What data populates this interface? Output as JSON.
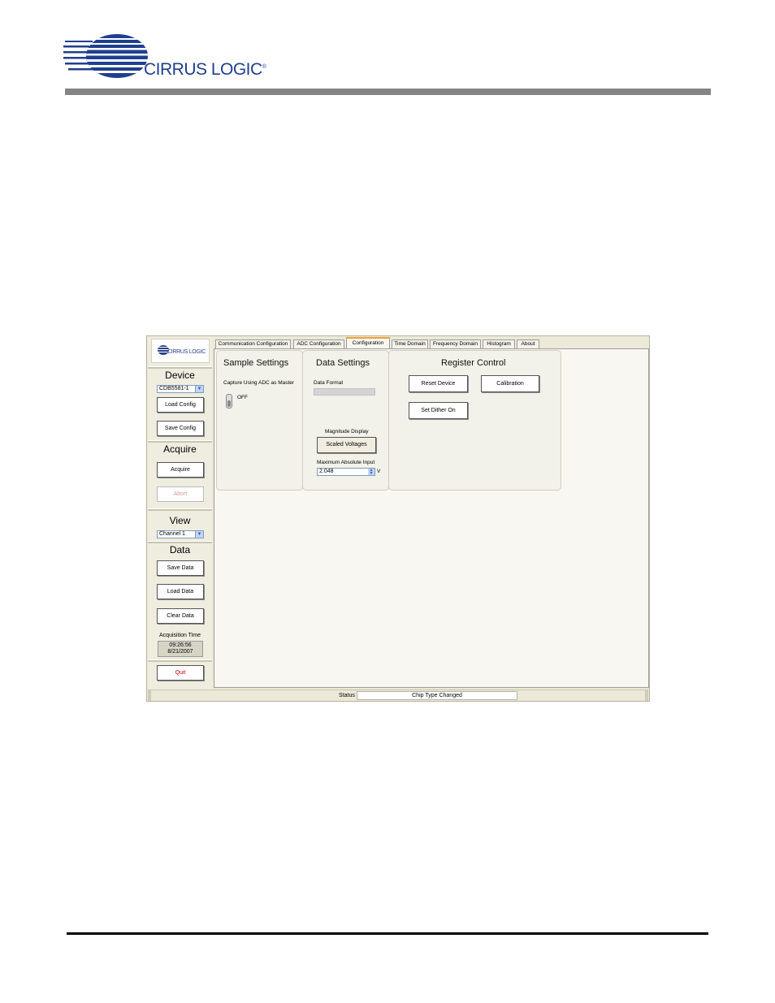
{
  "header": {
    "brand": "CIRRUS LOGIC",
    "registered": "®"
  },
  "sidebar": {
    "logo_text": "CIRRUS LOGIC",
    "device": {
      "heading": "Device",
      "selected_device": "CDB5581-1",
      "load_config": "Load Config",
      "save_config": "Save Config"
    },
    "acquire": {
      "heading": "Acquire",
      "acquire_button": "Acquire",
      "abort_button": "Abort"
    },
    "view": {
      "heading": "View",
      "selected_channel": "Channel 1"
    },
    "data": {
      "heading": "Data",
      "save_data": "Save Data",
      "load_data": "Load Data",
      "clear_data": "Clear Data",
      "acquisition_label": "Acquisition Time",
      "acquisition_time": "09:26:56",
      "acquisition_date": "8/21/2007"
    },
    "quit_button": "Quit"
  },
  "tabs": [
    {
      "label": "Communication Configuration"
    },
    {
      "label": "ADC Configuration"
    },
    {
      "label": "Configuration"
    },
    {
      "label": "Time Domain"
    },
    {
      "label": "Frequency Domain"
    },
    {
      "label": "Histogram"
    },
    {
      "label": "About"
    }
  ],
  "active_tab": "Configuration",
  "sample_settings": {
    "title": "Sample Settings",
    "capture_label": "Capture Using ADC as Master",
    "toggle_state": "OFF"
  },
  "data_settings": {
    "title": "Data Settings",
    "data_format_label": "Data Format",
    "magnitude_label": "Magnitude Display",
    "magnitude_button": "Scaled Voltages",
    "max_input_label": "Maximum Absolute Input",
    "max_input_value": "2.048",
    "max_input_unit": "V"
  },
  "register_control": {
    "title": "Register Control",
    "reset_device": "Reset Device",
    "calibration": "Calibration",
    "set_dither": "Set Dither On"
  },
  "status": {
    "label": "Status",
    "message": "Chip Type Changed"
  },
  "colors": {
    "brand_blue": "#1f3f8f",
    "active_tab_accent": "#f0a030",
    "header_bar": "#858585"
  }
}
